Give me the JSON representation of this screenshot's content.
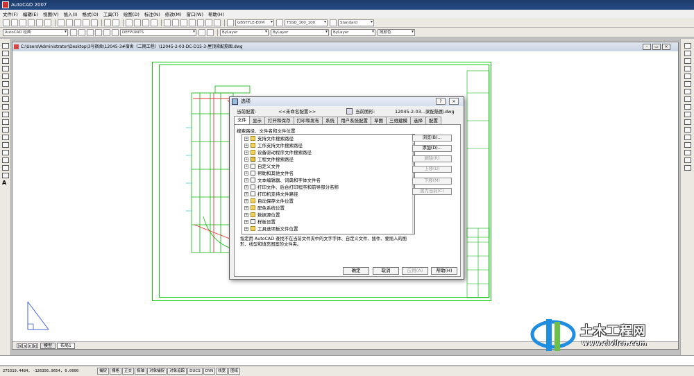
{
  "app": {
    "title": "AutoCAD 2007"
  },
  "menu": [
    "文件(F)",
    "编辑(E)",
    "视图(V)",
    "插入(I)",
    "格式(O)",
    "工具(T)",
    "绘图(D)",
    "标注(N)",
    "修改(M)",
    "窗口(W)",
    "帮助(H)"
  ],
  "toolbar1": {
    "textstyle": "GBSTYLE-EDM",
    "dimstyle": "TSSD_100_100",
    "tablestyle": "Standard"
  },
  "toolbar2": {
    "workspace": "AutoCAD 经典",
    "layer": "DEFPOINTS",
    "color": "ByLayer",
    "linetype": "ByLayer",
    "lineweight": "ByLayer",
    "plotstyle": "随颜色"
  },
  "drawing": {
    "path": "C:\\Users\\Administrator\\Desktop\\3号宿舍\\12045-3#宿舍（二期工程）\\12045-2-03-DC-D15-3-屋顶梁配筋图.dwg"
  },
  "layout_tabs": [
    "模型",
    "布局1"
  ],
  "status": {
    "coords": "275319.4484, -126356.9654, 0.0000",
    "buttons": [
      "捕捉",
      "栅格",
      "正交",
      "极轴",
      "对象捕捉",
      "对象追踪",
      "DUCS",
      "DYN",
      "线宽",
      "图纸"
    ]
  },
  "dialog": {
    "title": "选项",
    "profile_label": "当前配置:",
    "profile_value": "<<未命名配置>>",
    "drawing_label": "当前图形:",
    "drawing_value": "12045-2-03...梁配筋图.dwg",
    "tabs": [
      "文件",
      "显示",
      "打开和保存",
      "打印和发布",
      "系统",
      "用户系统配置",
      "草图",
      "三维建模",
      "选择",
      "配置"
    ],
    "paths_label": "搜索路径、文件名和文件位置",
    "tree": [
      {
        "label": "支持文件搜索路径",
        "icon": "folder"
      },
      {
        "label": "工作支持文件搜索路径",
        "icon": "folder"
      },
      {
        "label": "设备驱动程序文件搜索路径",
        "icon": "folder"
      },
      {
        "label": "工程文件搜索路径",
        "icon": "proj"
      },
      {
        "label": "自定义文件",
        "icon": "doc"
      },
      {
        "label": "帮助和其他文件名",
        "icon": "doc"
      },
      {
        "label": "文本编辑器、词典和字体文件名",
        "icon": "doc"
      },
      {
        "label": "打印文件、后台打印程序和前导部分名称",
        "icon": "doc"
      },
      {
        "label": "打印机支持文件路径",
        "icon": "doc"
      },
      {
        "label": "自动保存文件位置",
        "icon": "folder"
      },
      {
        "label": "配色系统位置",
        "icon": "folder"
      },
      {
        "label": "数据源位置",
        "icon": "folder"
      },
      {
        "label": "样板设置",
        "icon": "doc"
      },
      {
        "label": "工具选项板文件位置",
        "icon": "folder"
      }
    ],
    "side_buttons": {
      "browse": "浏览(B)...",
      "add": "添加(D)...",
      "remove": "删除(R)",
      "move_up": "上移(U)",
      "move_down": "下移(M)",
      "set_current": "置为当前(C)"
    },
    "description": "指定用 AutoCAD 查找不在当前文件夹中的文字字体、自定义文件、插件、要插入的图形、线型和填充图案的文件夹。",
    "buttons": {
      "ok": "确定",
      "cancel": "取消",
      "apply": "应用(A)",
      "help": "帮助(H)"
    }
  },
  "watermark": {
    "name": "土木工程网",
    "url": "www.civilcn.com"
  }
}
